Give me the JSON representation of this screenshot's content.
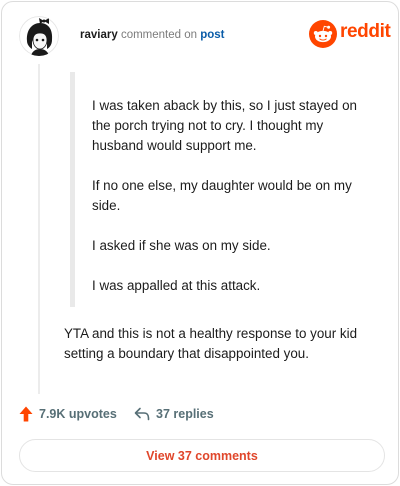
{
  "header": {
    "username": "raviary",
    "action_text": "commented on",
    "post_link": "post",
    "logo_text": "reddit",
    "logo_color": "#ff4500"
  },
  "quote": {
    "paragraphs": [
      "I was taken aback by this, so I just stayed on the porch trying not to cry. I thought my husband would support me.",
      "If no one else, my daughter would be on my side.",
      "I asked if she was on my side.",
      "I was appalled at this attack."
    ]
  },
  "comment": {
    "text": "YTA and this is not a healthy response to your kid setting a boundary that disappointed you."
  },
  "actions": {
    "upvotes_label": "7.9K upvotes",
    "replies_label": "37 replies",
    "upvote_icon": "upvote-arrow-icon",
    "reply_icon": "reply-arrow-icon",
    "upvote_color": "#ff4500"
  },
  "footer": {
    "view_comments_label": "View 37 comments",
    "button_text_color": "#e0462b"
  }
}
